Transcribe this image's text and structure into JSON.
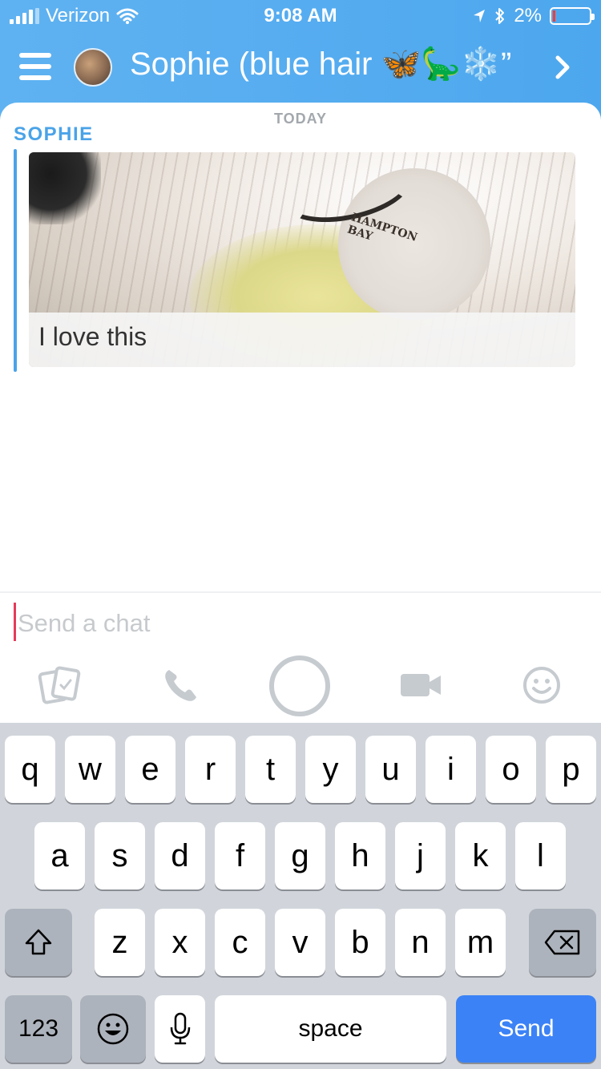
{
  "status_bar": {
    "carrier": "Verizon",
    "time": "9:08 AM",
    "battery": "2%",
    "battery_level": 0.02
  },
  "header": {
    "title": "Sophie (blue hair 🦋🦕❄️”",
    "menu_icon": "hamburger-icon",
    "chevron_icon": "chevron-right-icon"
  },
  "chat": {
    "date_label": "TODAY",
    "sender": "SOPHIE",
    "message_caption": "I love this",
    "media_text": "HAMPTON BAY"
  },
  "composer": {
    "placeholder": "Send a chat"
  },
  "tools": [
    {
      "name": "memories-icon"
    },
    {
      "name": "phone-icon"
    },
    {
      "name": "capture-icon"
    },
    {
      "name": "video-icon"
    },
    {
      "name": "emoji-icon"
    }
  ],
  "keyboard": {
    "row1": [
      "q",
      "w",
      "e",
      "r",
      "t",
      "y",
      "u",
      "i",
      "o",
      "p"
    ],
    "row2": [
      "a",
      "s",
      "d",
      "f",
      "g",
      "h",
      "j",
      "k",
      "l"
    ],
    "row3": [
      "z",
      "x",
      "c",
      "v",
      "b",
      "n",
      "m"
    ],
    "numbers_label": "123",
    "space_label": "space",
    "send_label": "Send"
  },
  "colors": {
    "accent": "#4aa3e8",
    "send": "#3b82f6",
    "cursor": "#e53b5a"
  }
}
